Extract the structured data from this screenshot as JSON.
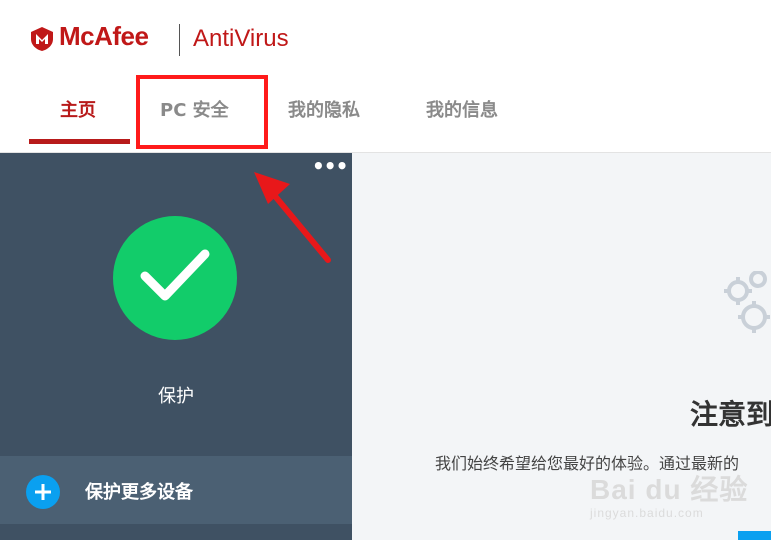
{
  "header": {
    "brand": "McAfee",
    "product": "AntiVirus"
  },
  "tabs": [
    {
      "label": "主页",
      "active": true
    },
    {
      "label": "PC 安全",
      "active": false
    },
    {
      "label": "我的隐私",
      "active": false
    },
    {
      "label": "我的信息",
      "active": false
    }
  ],
  "status": {
    "label": "保护",
    "icon": "checkmark-icon",
    "color": "#12cc6a"
  },
  "more_menu": {
    "label": "•••"
  },
  "devices": {
    "label": "保护更多设备",
    "icon": "plus-icon"
  },
  "notice": {
    "title": "注意到",
    "body": "我们始终希望给您最好的体验。通过最新的"
  },
  "watermark": {
    "main": "Bai du 经验",
    "sub": "jingyan.baidu.com"
  },
  "colors": {
    "brand_red": "#c01818",
    "annotation_red": "#ff1a1a",
    "panel_dark": "#3f5163",
    "accent_blue": "#0aa0f0"
  }
}
